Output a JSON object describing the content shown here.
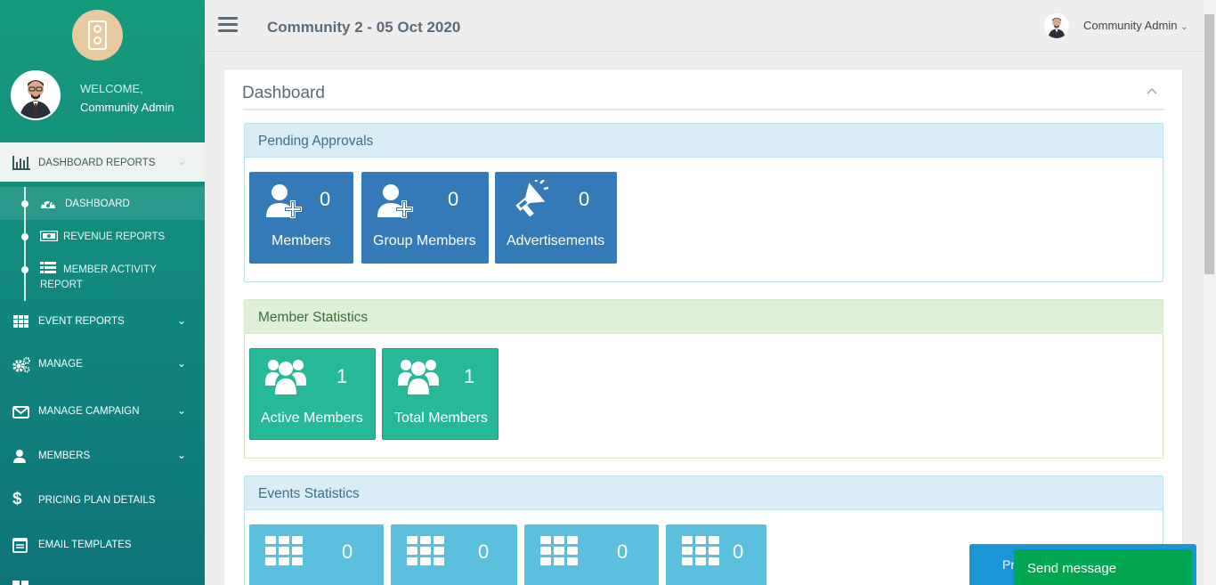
{
  "sidebar": {
    "welcome": "WELCOME,",
    "user_name": "Community Admin",
    "active_group": {
      "label": "DASHBOARD REPORTS",
      "icon": "bar-chart-icon"
    },
    "sub_items": [
      {
        "label": "DASHBOARD",
        "icon": "dashboard-icon"
      },
      {
        "label": "REVENUE REPORTS",
        "icon": "money-icon"
      },
      {
        "label": "MEMBER ACTIVITY",
        "label2": "REPORT",
        "icon": "list-icon"
      }
    ],
    "items": [
      {
        "label": "EVENT REPORTS",
        "icon": "grid-icon"
      },
      {
        "label": "MANAGE",
        "icon": "cogs-icon"
      },
      {
        "label": "MANAGE CAMPAIGN",
        "icon": "envelope-icon"
      },
      {
        "label": "MEMBERS",
        "icon": "user-icon"
      },
      {
        "label": "PRICING PLAN DETAILS",
        "icon": "dollar-icon"
      },
      {
        "label": "EMAIL TEMPLATES",
        "icon": "template-icon"
      }
    ]
  },
  "header": {
    "title": "Community 2 - 05 Oct 2020",
    "user": "Community Admin"
  },
  "main": {
    "title": "Dashboard",
    "pending": {
      "title": "Pending Approvals",
      "tiles": [
        {
          "label": "Members",
          "count": "0",
          "icon": "user-plus-icon"
        },
        {
          "label": "Group Members",
          "count": "0",
          "icon": "user-plus-icon"
        },
        {
          "label": "Advertisements",
          "count": "0",
          "icon": "megaphone-icon"
        }
      ]
    },
    "member_stats": {
      "title": "Member Statistics",
      "tiles": [
        {
          "label": "Active Members",
          "count": "1",
          "icon": "users-icon"
        },
        {
          "label": "Total Members",
          "count": "1",
          "icon": "users-icon"
        }
      ]
    },
    "event_stats": {
      "title": "Events Statistics",
      "tiles": [
        {
          "count": "0",
          "icon": "calendar-grid-icon"
        },
        {
          "count": "0",
          "icon": "calendar-grid-icon"
        },
        {
          "count": "0",
          "icon": "calendar-grid-icon"
        },
        {
          "count": "0",
          "icon": "calendar-grid-icon"
        }
      ]
    }
  },
  "chat": {
    "hidden_label": "Pr",
    "send_label": "Send message"
  },
  "colors": {
    "sidebar": "#169b7c",
    "tile_blue": "#337ab7",
    "tile_green": "#26b897",
    "tile_cyan": "#5bc0de"
  }
}
